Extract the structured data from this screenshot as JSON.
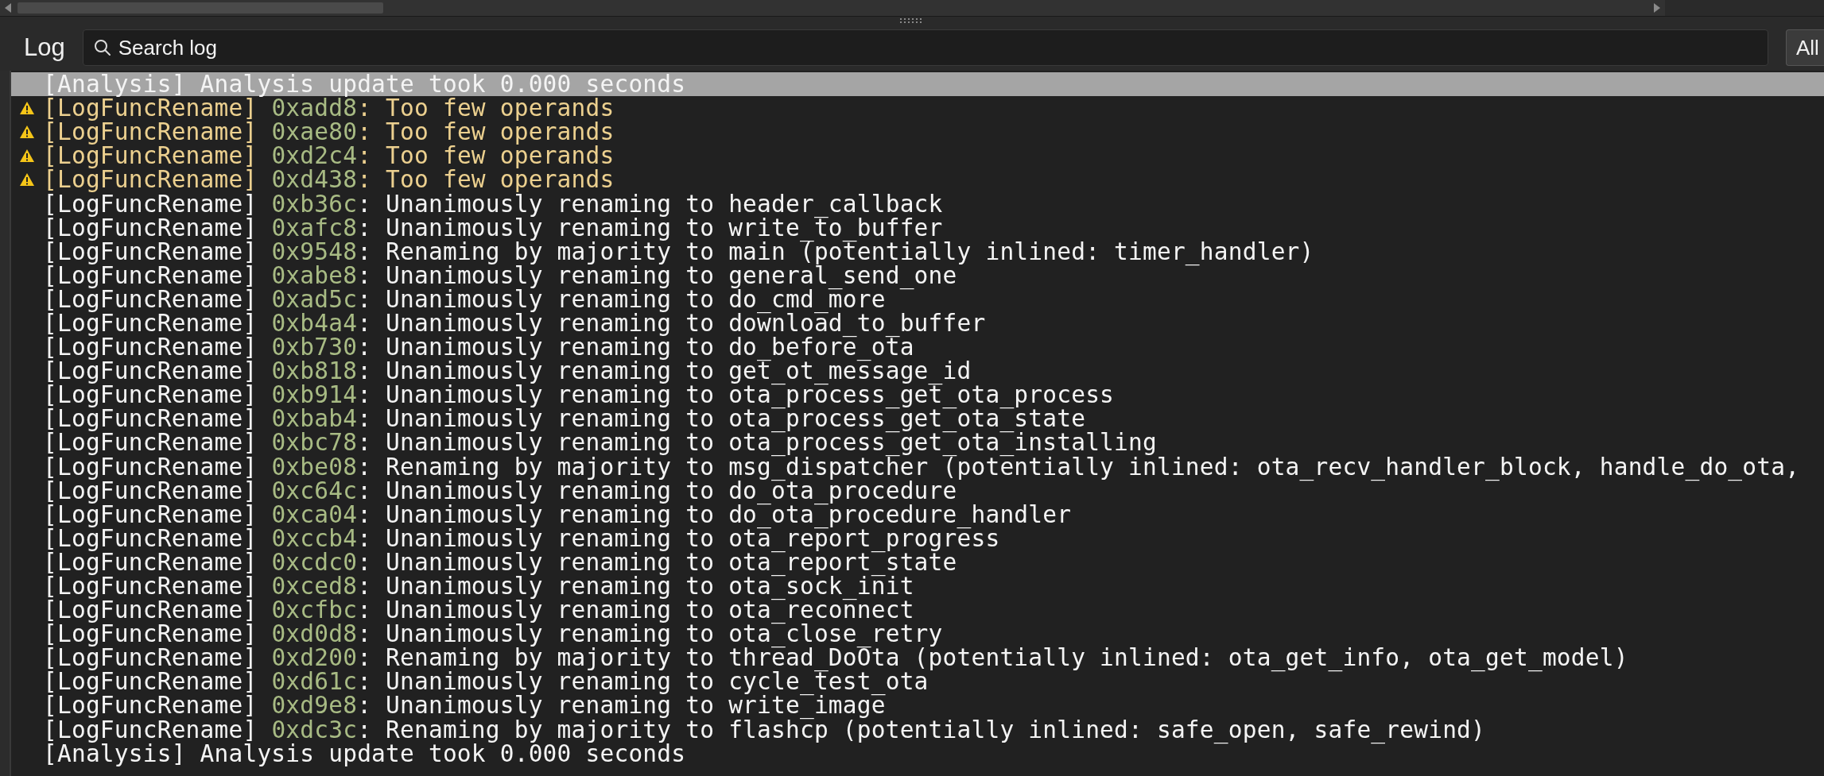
{
  "panel": {
    "title": "Log"
  },
  "search": {
    "placeholder": "Search log"
  },
  "filter_button": {
    "label": "All"
  },
  "rows": [
    {
      "kind": "info",
      "selected": true,
      "source": "[Analysis]",
      "address": "",
      "text": " Analysis update took 0.000 seconds"
    },
    {
      "kind": "warning",
      "selected": false,
      "source": "[LogFuncRename]",
      "address": "0xadd8",
      "text": ": Too few operands"
    },
    {
      "kind": "warning",
      "selected": false,
      "source": "[LogFuncRename]",
      "address": "0xae80",
      "text": ": Too few operands"
    },
    {
      "kind": "warning",
      "selected": false,
      "source": "[LogFuncRename]",
      "address": "0xd2c4",
      "text": ": Too few operands"
    },
    {
      "kind": "warning",
      "selected": false,
      "source": "[LogFuncRename]",
      "address": "0xd438",
      "text": ": Too few operands"
    },
    {
      "kind": "info",
      "selected": false,
      "source": "[LogFuncRename]",
      "address": "0xb36c",
      "text": ": Unanimously renaming to header_callback"
    },
    {
      "kind": "info",
      "selected": false,
      "source": "[LogFuncRename]",
      "address": "0xafc8",
      "text": ": Unanimously renaming to write_to_buffer"
    },
    {
      "kind": "info",
      "selected": false,
      "source": "[LogFuncRename]",
      "address": "0x9548",
      "text": ": Renaming by majority to main (potentially inlined: timer_handler)"
    },
    {
      "kind": "info",
      "selected": false,
      "source": "[LogFuncRename]",
      "address": "0xabe8",
      "text": ": Unanimously renaming to general_send_one"
    },
    {
      "kind": "info",
      "selected": false,
      "source": "[LogFuncRename]",
      "address": "0xad5c",
      "text": ": Unanimously renaming to do_cmd_more"
    },
    {
      "kind": "info",
      "selected": false,
      "source": "[LogFuncRename]",
      "address": "0xb4a4",
      "text": ": Unanimously renaming to download_to_buffer"
    },
    {
      "kind": "info",
      "selected": false,
      "source": "[LogFuncRename]",
      "address": "0xb730",
      "text": ": Unanimously renaming to do_before_ota"
    },
    {
      "kind": "info",
      "selected": false,
      "source": "[LogFuncRename]",
      "address": "0xb818",
      "text": ": Unanimously renaming to get_ot_message_id"
    },
    {
      "kind": "info",
      "selected": false,
      "source": "[LogFuncRename]",
      "address": "0xb914",
      "text": ": Unanimously renaming to ota_process_get_ota_process"
    },
    {
      "kind": "info",
      "selected": false,
      "source": "[LogFuncRename]",
      "address": "0xbab4",
      "text": ": Unanimously renaming to ota_process_get_ota_state"
    },
    {
      "kind": "info",
      "selected": false,
      "source": "[LogFuncRename]",
      "address": "0xbc78",
      "text": ": Unanimously renaming to ota_process_get_ota_installing"
    },
    {
      "kind": "info",
      "selected": false,
      "source": "[LogFuncRename]",
      "address": "0xbe08",
      "text": ": Renaming by majority to msg_dispatcher (potentially inlined: ota_recv_handler_block, handle_do_ota,"
    },
    {
      "kind": "info",
      "selected": false,
      "source": "[LogFuncRename]",
      "address": "0xc64c",
      "text": ": Unanimously renaming to do_ota_procedure"
    },
    {
      "kind": "info",
      "selected": false,
      "source": "[LogFuncRename]",
      "address": "0xca04",
      "text": ": Unanimously renaming to do_ota_procedure_handler"
    },
    {
      "kind": "info",
      "selected": false,
      "source": "[LogFuncRename]",
      "address": "0xccb4",
      "text": ": Unanimously renaming to ota_report_progress"
    },
    {
      "kind": "info",
      "selected": false,
      "source": "[LogFuncRename]",
      "address": "0xcdc0",
      "text": ": Unanimously renaming to ota_report_state"
    },
    {
      "kind": "info",
      "selected": false,
      "source": "[LogFuncRename]",
      "address": "0xced8",
      "text": ": Unanimously renaming to ota_sock_init"
    },
    {
      "kind": "info",
      "selected": false,
      "source": "[LogFuncRename]",
      "address": "0xcfbc",
      "text": ": Unanimously renaming to ota_reconnect"
    },
    {
      "kind": "info",
      "selected": false,
      "source": "[LogFuncRename]",
      "address": "0xd0d8",
      "text": ": Unanimously renaming to ota_close_retry"
    },
    {
      "kind": "info",
      "selected": false,
      "source": "[LogFuncRename]",
      "address": "0xd200",
      "text": ": Renaming by majority to thread_DoOta (potentially inlined: ota_get_info, ota_get_model)"
    },
    {
      "kind": "info",
      "selected": false,
      "source": "[LogFuncRename]",
      "address": "0xd61c",
      "text": ": Unanimously renaming to cycle_test_ota"
    },
    {
      "kind": "info",
      "selected": false,
      "source": "[LogFuncRename]",
      "address": "0xd9e8",
      "text": ": Unanimously renaming to write_image"
    },
    {
      "kind": "info",
      "selected": false,
      "source": "[LogFuncRename]",
      "address": "0xdc3c",
      "text": ": Renaming by majority to flashcp (potentially inlined: safe_open, safe_rewind)"
    },
    {
      "kind": "info",
      "selected": false,
      "source": "[Analysis]",
      "address": "",
      "text": " Analysis update took 0.000 seconds"
    }
  ]
}
